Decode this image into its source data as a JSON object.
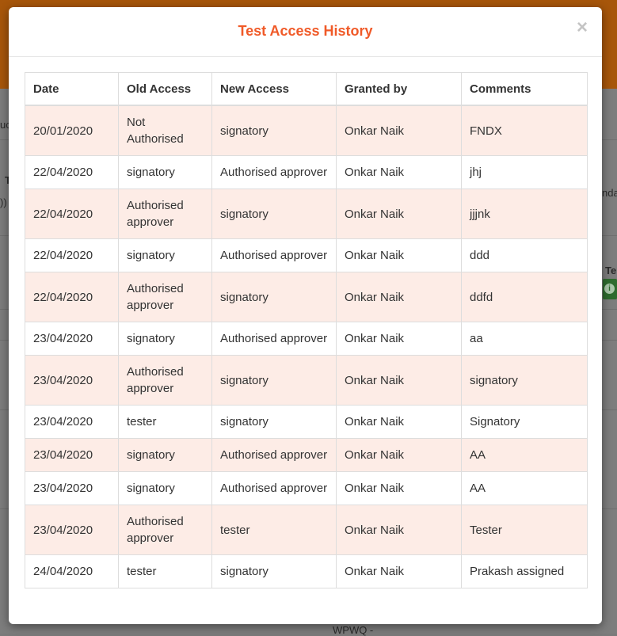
{
  "background": {
    "fragments": [
      "uc",
      "T",
      "))",
      "nda",
      "Te",
      "WPWQ -"
    ]
  },
  "modal": {
    "title": "Test Access History",
    "close_glyph": "×"
  },
  "table": {
    "headers": [
      "Date",
      "Old Access",
      "New Access",
      "Granted by",
      "Comments"
    ],
    "rows": [
      {
        "date": "20/01/2020",
        "old": "Not Authorised",
        "new": "signatory",
        "by": "Onkar Naik",
        "comment": "FNDX"
      },
      {
        "date": "22/04/2020",
        "old": "signatory",
        "new": "Authorised approver",
        "by": "Onkar Naik",
        "comment": "jhj"
      },
      {
        "date": "22/04/2020",
        "old": "Authorised approver",
        "new": "signatory",
        "by": "Onkar Naik",
        "comment": "jjjnk"
      },
      {
        "date": "22/04/2020",
        "old": "signatory",
        "new": "Authorised approver",
        "by": "Onkar Naik",
        "comment": "ddd"
      },
      {
        "date": "22/04/2020",
        "old": "Authorised approver",
        "new": "signatory",
        "by": "Onkar Naik",
        "comment": "ddfd"
      },
      {
        "date": "23/04/2020",
        "old": "signatory",
        "new": "Authorised approver",
        "by": "Onkar Naik",
        "comment": "aa"
      },
      {
        "date": "23/04/2020",
        "old": "Authorised approver",
        "new": "signatory",
        "by": "Onkar Naik",
        "comment": "signatory"
      },
      {
        "date": "23/04/2020",
        "old": "tester",
        "new": "signatory",
        "by": "Onkar Naik",
        "comment": "Signatory"
      },
      {
        "date": "23/04/2020",
        "old": "signatory",
        "new": "Authorised approver",
        "by": "Onkar Naik",
        "comment": "AA"
      },
      {
        "date": "23/04/2020",
        "old": "signatory",
        "new": "Authorised approver",
        "by": "Onkar Naik",
        "comment": "AA"
      },
      {
        "date": "23/04/2020",
        "old": "Authorised approver",
        "new": "tester",
        "by": "Onkar Naik",
        "comment": "Tester"
      },
      {
        "date": "24/04/2020",
        "old": "tester",
        "new": "signatory",
        "by": "Onkar Naik",
        "comment": "Prakash assigned"
      }
    ]
  },
  "colors": {
    "title": "#f05a28",
    "row_shade": "#fdece6",
    "border": "#dddddd"
  }
}
